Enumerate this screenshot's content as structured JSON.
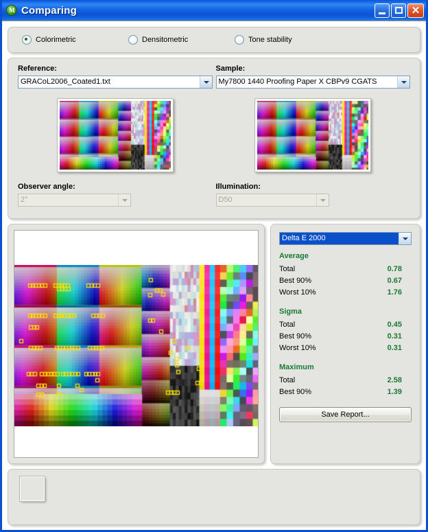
{
  "window": {
    "title": "Comparing",
    "icon": "app-globe-icon",
    "buttons": {
      "minimize": "Minimize",
      "maximize": "Maximize",
      "close": "Close"
    }
  },
  "modes": {
    "items": [
      {
        "label": "Colorimetric",
        "selected": true
      },
      {
        "label": "Densitometric",
        "selected": false
      },
      {
        "label": "Tone stability",
        "selected": false
      }
    ]
  },
  "selection": {
    "reference": {
      "label": "Reference:",
      "value": "GRACoL2006_Coated1.txt"
    },
    "sample": {
      "label": "Sample:",
      "value": "My7800 1440 Proofing Paper X CBPv9 CGATS"
    },
    "observer": {
      "label": "Observer angle:",
      "value": "2°",
      "disabled": true
    },
    "illumination": {
      "label": "Illumination:",
      "value": "D50",
      "disabled": true
    }
  },
  "results": {
    "metric": {
      "value": "Delta E 2000"
    },
    "groups": [
      {
        "title": "Average",
        "rows": [
          {
            "key": "Total",
            "value": "0.78"
          },
          {
            "key": "Best 90%",
            "value": "0.67"
          },
          {
            "key": "Worst 10%",
            "value": "1.76"
          }
        ]
      },
      {
        "title": "Sigma",
        "rows": [
          {
            "key": "Total",
            "value": "0.45"
          },
          {
            "key": "Best 90%",
            "value": "0.31"
          },
          {
            "key": "Worst 10%",
            "value": "0.31"
          }
        ]
      },
      {
        "title": "Maximum",
        "rows": [
          {
            "key": "Total",
            "value": "2.58"
          },
          {
            "key": "Best 90%",
            "value": "1.39"
          }
        ]
      }
    ],
    "save_report_label": "Save Report..."
  },
  "colors": {
    "accent_green": "#1a7a34",
    "title_blue": "#0b50d0",
    "panel_gray": "#e4e4e0",
    "marker_yellow": "#ffe000",
    "selection_blue": "#0a50c8"
  },
  "chart_data": {
    "type": "heatmap",
    "title": "",
    "description": "CGATS color patch map comparing reference and sample; yellow outlines mark patches exceeding the Delta E tolerance.",
    "grid": {
      "columns": 60,
      "rows": 34
    },
    "marker_color": "#ffe000",
    "legend": []
  }
}
